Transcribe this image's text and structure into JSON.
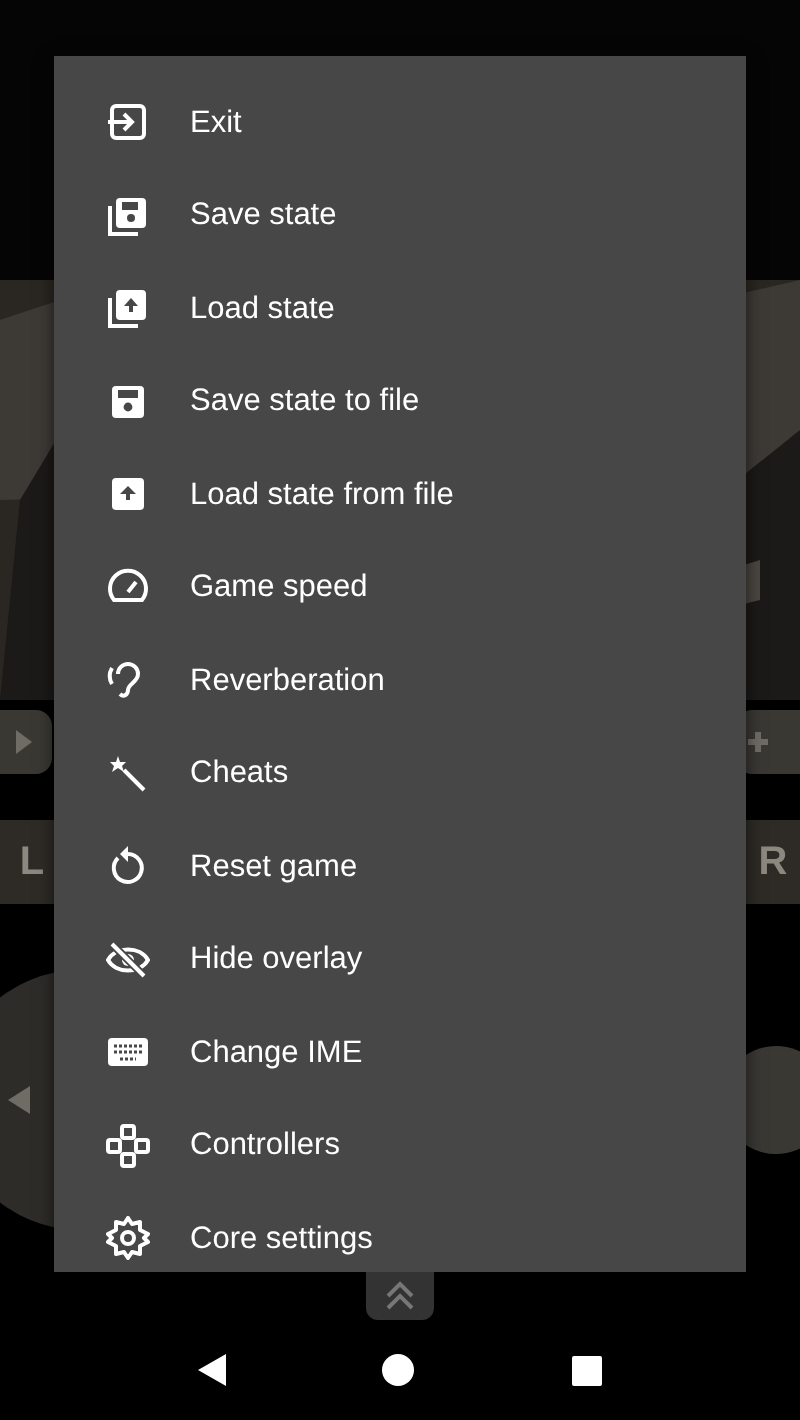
{
  "overlay": {
    "shoulder_buttons": [
      "L",
      "R"
    ]
  },
  "menu": {
    "items": [
      {
        "label": "Exit"
      },
      {
        "label": "Save state"
      },
      {
        "label": "Load state"
      },
      {
        "label": "Save state to file"
      },
      {
        "label": "Load state from file"
      },
      {
        "label": "Game speed"
      },
      {
        "label": "Reverberation"
      },
      {
        "label": "Cheats"
      },
      {
        "label": "Reset game"
      },
      {
        "label": "Hide overlay"
      },
      {
        "label": "Change IME"
      },
      {
        "label": "Controllers"
      },
      {
        "label": "Core settings"
      }
    ]
  }
}
